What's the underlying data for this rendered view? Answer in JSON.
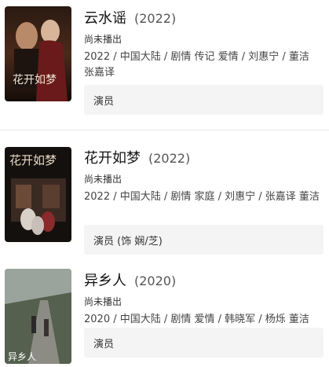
{
  "items": [
    {
      "title": "云水谣",
      "year": "(2022)",
      "status": "尚未播出",
      "meta": "2022 / 中国大陆 / 剧情 传记 爱情 / 刘惠宁 / 董洁 张嘉译",
      "role": "演员",
      "poster_text": "花开如梦"
    },
    {
      "title": "花开如梦",
      "year": "(2022)",
      "status": "尚未播出",
      "meta": "2022 / 中国大陆 / 剧情 家庭 / 刘惠宁 / 张嘉译 董洁",
      "role": "演员 (饰 娴/芝)",
      "poster_text": "花开如梦"
    },
    {
      "title": "异乡人",
      "year": "(2020)",
      "status": "尚未播出",
      "meta": "2020 / 中国大陆 / 剧情 爱情 / 韩晓军 / 杨烁 董洁",
      "role": "演员"
    }
  ]
}
